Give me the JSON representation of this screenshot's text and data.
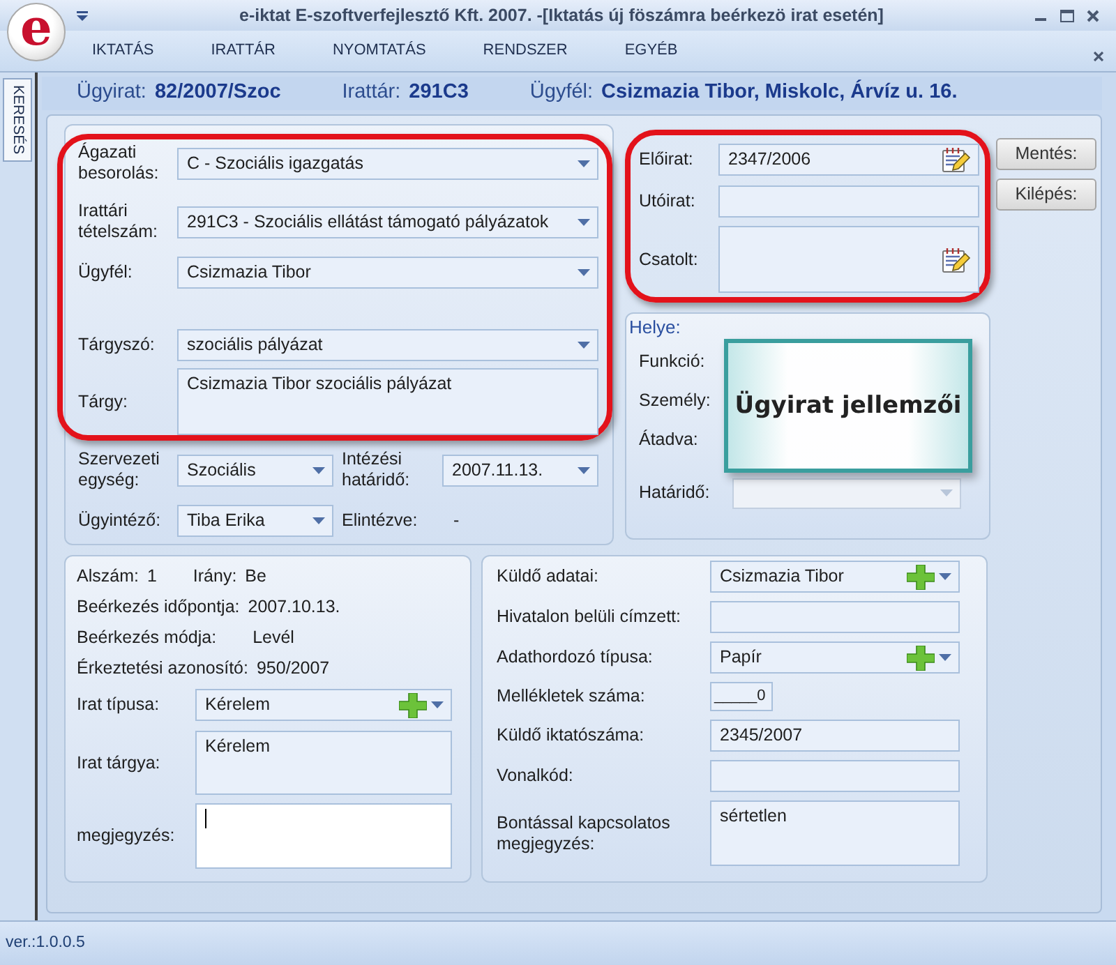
{
  "window": {
    "logo": "e",
    "title": "e-iktat E-szoftverfejlesztő Kft. 2007. -[Iktatás új föszámra beérkezö irat esetén]",
    "menu": [
      "IKTATÁS",
      "IRATTÁR",
      "NYOMTATÁS",
      "RENDSZER",
      "EGYÉB"
    ]
  },
  "side_tabs": [
    {
      "label": "KERESÉS",
      "selected": true
    }
  ],
  "header": [
    {
      "label": "Ügyirat:",
      "value": "82/2007/Szoc"
    },
    {
      "label": "Irattár:",
      "value": "291C3"
    },
    {
      "label": "Ügyfél:",
      "value": "Csizmazia Tibor, Miskolc, Árvíz u. 16."
    }
  ],
  "classification": {
    "fields": [
      {
        "label": "Ágazati besorolás:",
        "kind": "select",
        "value": "C - Szociális igazgatás"
      },
      {
        "label": "Irattári tételszám:",
        "kind": "select",
        "value": "291C3 - Szociális ellátást támogató pályázatok"
      },
      {
        "label": "Ügyfél:",
        "kind": "select",
        "value": "Csizmazia Tibor"
      },
      {
        "label": "Tárgyszó:",
        "kind": "select",
        "value": "szociális pályázat"
      },
      {
        "label": "Tárgy:",
        "kind": "textarea",
        "value": "Csizmazia Tibor szociális pályázat"
      }
    ]
  },
  "assignment": {
    "rows": [
      [
        {
          "label": "Szervezeti egység:",
          "kind": "select",
          "value": "Szociális"
        },
        {
          "label": "Intézési határidő:",
          "kind": "select",
          "value": "2007.11.13."
        }
      ],
      [
        {
          "label": "Ügyintéző:",
          "kind": "select",
          "value": "Tiba Erika"
        },
        {
          "label": "Elintézve:",
          "kind": "readonly",
          "value": "-"
        }
      ]
    ]
  },
  "references": {
    "fields": [
      {
        "label": "Előirat:",
        "kind": "picker",
        "value": "2347/2006"
      },
      {
        "label": "Utóirat:",
        "kind": "text"
      },
      {
        "label": "Csatolt:",
        "kind": "pickerarea"
      }
    ]
  },
  "location": {
    "title": "Helye:",
    "fields": [
      {
        "label": "Funkció:",
        "kind": "label"
      },
      {
        "label": "Személy:",
        "kind": "label"
      },
      {
        "label": "Átadva:",
        "kind": "label"
      },
      {
        "label": "Határidő:",
        "kind": "greyed"
      }
    ]
  },
  "callout": "Ügyirat jellemzői",
  "buttons": [
    "Mentés:",
    "Kilépés:"
  ],
  "document": {
    "info": [
      [
        {
          "label": "Alszám:",
          "value": "1"
        },
        {
          "label": "Irány:",
          "value": "Be"
        }
      ],
      [
        {
          "label": "Beérkezés időpontja:",
          "value": "2007.10.13."
        }
      ],
      [
        {
          "label": "Beérkezés módja:",
          "value": "Levél"
        }
      ],
      [
        {
          "label": "Érkeztetési azonosító:",
          "value": "950/2007"
        }
      ]
    ],
    "fields": [
      {
        "label": "Irat típusa:",
        "kind": "addselect",
        "value": "Kérelem"
      },
      {
        "label": "Irat tárgya:",
        "kind": "textarea",
        "value": "Kérelem",
        "focused": false
      },
      {
        "label": "megjegyzés:",
        "kind": "textarea",
        "focused": true
      }
    ]
  },
  "sender": {
    "fields": [
      {
        "label": "Küldő adatai:",
        "kind": "addselect",
        "value": "Csizmazia Tibor"
      },
      {
        "label": "Hivatalon belüli címzett:",
        "kind": "text"
      },
      {
        "label": "Adathordozó típusa:",
        "kind": "addselect",
        "value": "Papír"
      },
      {
        "label": "Mellékletek száma:",
        "kind": "number",
        "value": "_____0"
      },
      {
        "label": "Küldő iktatószáma:",
        "kind": "text",
        "value": "2345/2007"
      },
      {
        "label": "Vonalkód:",
        "kind": "text"
      },
      {
        "label": "Bontással kapcsolatos megjegyzés:",
        "kind": "textarea",
        "value": "sértetlen"
      }
    ]
  },
  "status_bar": "ver.:1.0.0.5"
}
